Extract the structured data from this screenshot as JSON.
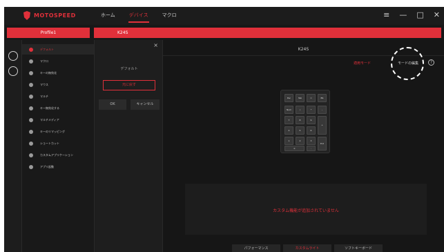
{
  "app": {
    "brand": "MOTOSPEED",
    "nav": [
      "ホーム",
      "デバイス",
      "マクロ"
    ],
    "active_nav": "デバイス",
    "window_controls": [
      "≡",
      "—",
      "□",
      "✕"
    ]
  },
  "profile": {
    "profile_label": "Profile1",
    "device_label": "K24S"
  },
  "sidemenu": {
    "items": [
      {
        "label": "デフォルト",
        "active": true
      },
      {
        "label": "マクロ"
      },
      {
        "label": "キーの無効化"
      },
      {
        "label": "マウス"
      },
      {
        "label": "マルチ"
      },
      {
        "label": "キー無効化する"
      },
      {
        "label": "マルチメディア"
      },
      {
        "label": "キーのリマッピング"
      },
      {
        "label": "ショートカット"
      },
      {
        "label": "カスタムアプリケーション"
      },
      {
        "label": "アプリ起動"
      }
    ]
  },
  "popup": {
    "close": "×",
    "title": "デフォルト",
    "restore_button": "元に戻す",
    "ok_button": "OK",
    "cancel_button": "キャンセル"
  },
  "main": {
    "title": "K24S",
    "apply_mode": "適用モード",
    "mode_edit": "モードの編集",
    "help": "?",
    "no_custom_message": "カスタム機能が追加されていません",
    "tabs": [
      "パフォーマンス",
      "カスタムライト",
      "ソフトキーボード"
    ]
  },
  "keypad": {
    "keys": [
      "Esc",
      "Tab",
      "=",
      "BS",
      "Num",
      "/",
      "*",
      "-",
      "7",
      "8",
      "9",
      "+",
      "4",
      "5",
      "6",
      "1",
      "2",
      "3",
      "Ent",
      "0",
      "."
    ]
  },
  "colors": {
    "accent": "#e0303a",
    "background": "#141414"
  }
}
